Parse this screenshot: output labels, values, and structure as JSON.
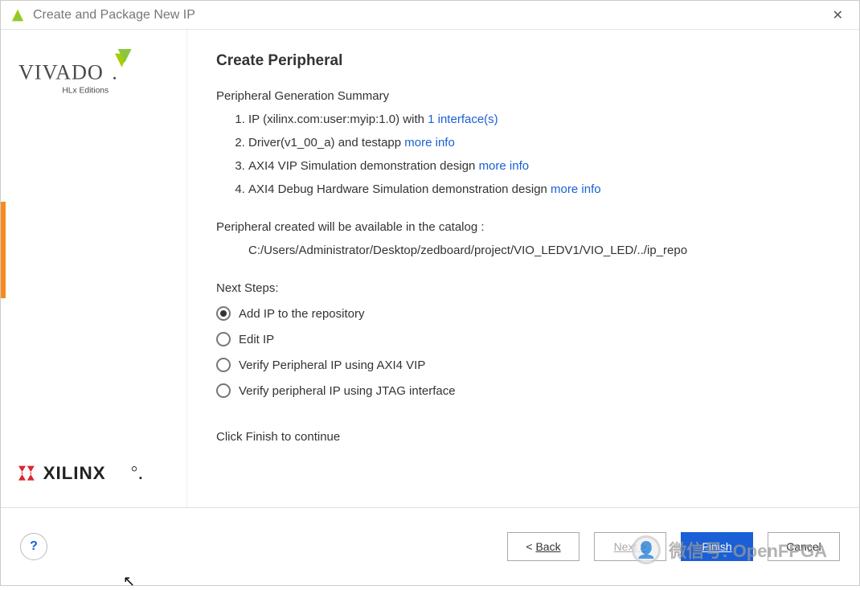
{
  "window": {
    "title": "Create and Package New IP"
  },
  "brand": {
    "product": "VIVADO",
    "edition": "HLx Editions",
    "vendor": "XILINX"
  },
  "page": {
    "title": "Create Peripheral",
    "summary_label": "Peripheral Generation Summary",
    "items": [
      {
        "text": "IP (xilinx.com:user:myip:1.0) with ",
        "link": "1 interface(s)"
      },
      {
        "text": "Driver(v1_00_a) and testapp ",
        "link": "more info"
      },
      {
        "text": "AXI4 VIP Simulation demonstration design ",
        "link": "more info"
      },
      {
        "text": "AXI4 Debug Hardware Simulation demonstration design ",
        "link": "more info"
      }
    ],
    "catalog_label": "Peripheral created will be available in the catalog :",
    "catalog_path": "C:/Users/Administrator/Desktop/zedboard/project/VIO_LEDV1/VIO_LED/../ip_repo",
    "next_steps_label": "Next Steps:",
    "next_steps": [
      {
        "label": "Add IP to the repository",
        "selected": true
      },
      {
        "label": "Edit IP",
        "selected": false
      },
      {
        "label": "Verify Peripheral IP using AXI4 VIP",
        "selected": false
      },
      {
        "label": "Verify peripheral IP using JTAG interface",
        "selected": false
      }
    ],
    "continue_text": "Click Finish to continue"
  },
  "footer": {
    "help": "?",
    "back_prefix": "< ",
    "back": "Back",
    "next": "Next >",
    "finish": "Finish",
    "cancel": "Cancel"
  },
  "watermark": "微信号: OpenFPGA"
}
